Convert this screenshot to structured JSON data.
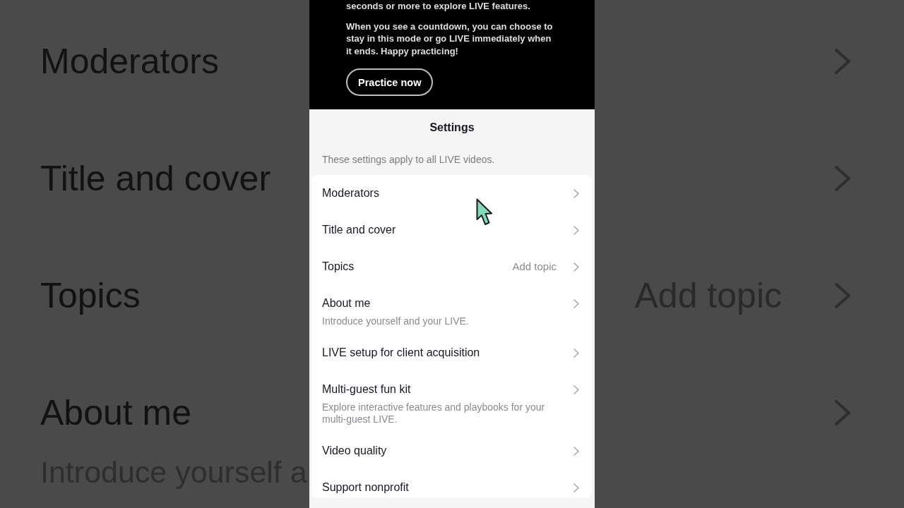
{
  "backdrop": {
    "rows": [
      {
        "label": "Moderators"
      },
      {
        "label": "Title and cover"
      },
      {
        "label": "Topics",
        "value": "Add topic"
      },
      {
        "label": "About me",
        "description": "Introduce yourself a"
      }
    ]
  },
  "promo": {
    "paragraphs": [
      "seconds or more to explore LIVE features.",
      "When you see a countdown, you can choose to stay in this mode or go LIVE immediately when it ends. Happy practicing!"
    ],
    "button": "Practice now"
  },
  "settings": {
    "title": "Settings",
    "subtitle": "These settings apply to all LIVE videos.",
    "items": [
      {
        "label": "Moderators"
      },
      {
        "label": "Title and cover"
      },
      {
        "label": "Topics",
        "value": "Add topic"
      },
      {
        "label": "About me",
        "description": "Introduce yourself and your LIVE."
      },
      {
        "label": "LIVE setup for client acquisition"
      },
      {
        "label": "Multi-guest fun kit",
        "description": "Explore interactive features and playbooks for your multi-guest LIVE."
      },
      {
        "label": "Video quality"
      },
      {
        "label": "Support nonprofit"
      }
    ]
  }
}
